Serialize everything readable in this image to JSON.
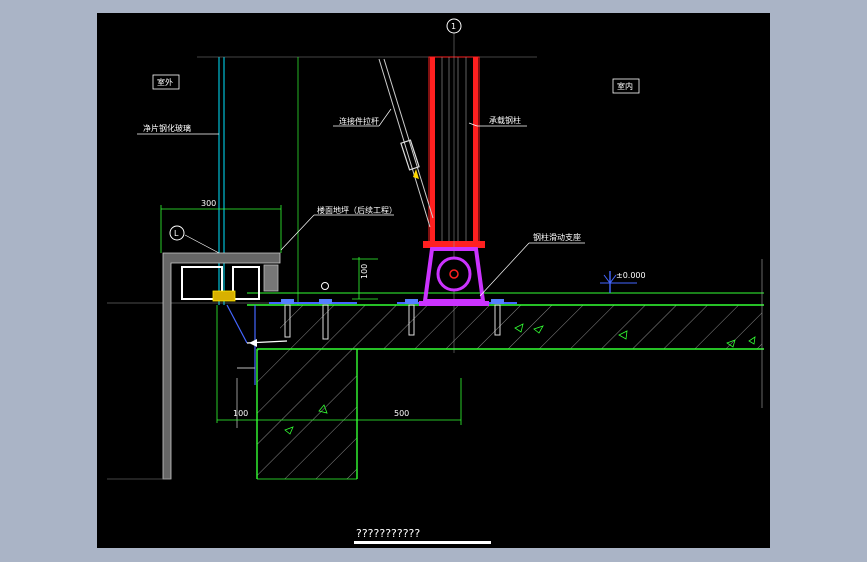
{
  "labels": {
    "outdoor": "室外",
    "indoor": "室内",
    "glass": "净片钢化玻璃",
    "rod": "连接件拉杆",
    "steel_col": "承载钢柱",
    "floor": "楼面地坪（后续工程）",
    "support": "钢柱滑动支座",
    "elevation": "±0.000",
    "grid_top": "1",
    "grid_left": "L"
  },
  "dimensions": {
    "d300": "300",
    "d100_vert": "100",
    "d100_bottom": "100",
    "d500": "500"
  },
  "title": "???????????",
  "colors": {
    "background": "#000000",
    "frame": "#aab4c6",
    "steel": "#ff2020",
    "support": "#cc33ff",
    "concrete": "#33ff33",
    "glass": "#00e5ff",
    "dim": "#33ff33",
    "anchor": "#4466ff"
  }
}
